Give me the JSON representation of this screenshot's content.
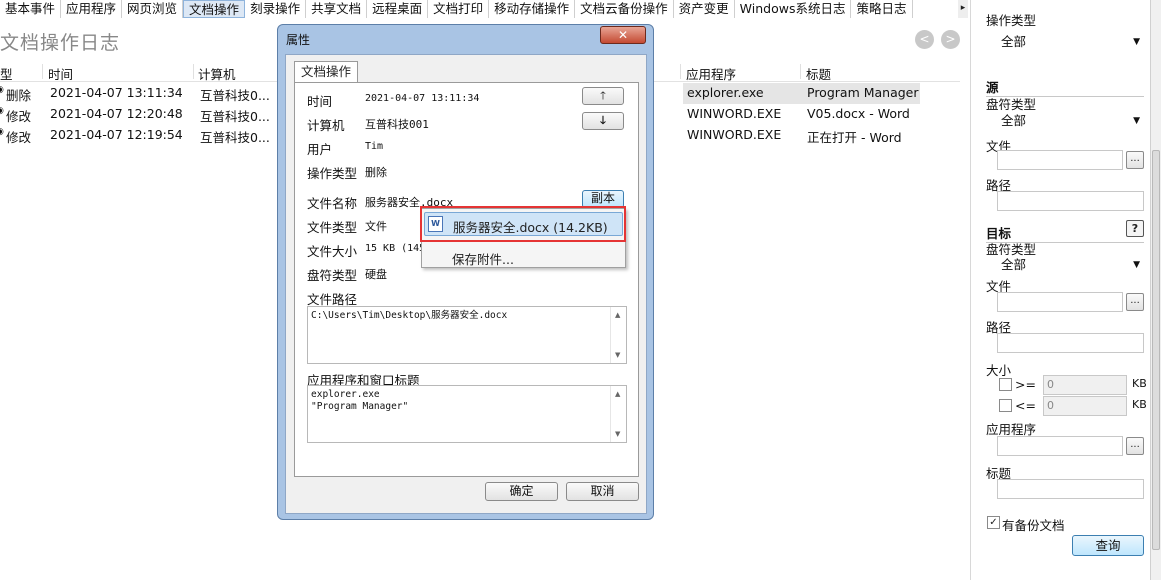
{
  "tabs": [
    "基本事件",
    "应用程序",
    "网页浏览",
    "文档操作",
    "刻录操作",
    "共享文档",
    "远程桌面",
    "文档打印",
    "移动存储操作",
    "文档云备份操作",
    "资产变更",
    "Windows系统日志",
    "策略日志"
  ],
  "active_tab_index": 3,
  "main_title": "文档操作日志",
  "nav": {
    "back": "<",
    "forward": ">"
  },
  "list": {
    "columns": {
      "type": "型",
      "time": "时间",
      "computer": "计算机",
      "app": "应用程序",
      "title": "标题"
    },
    "rows": [
      {
        "type": "删除",
        "time": "2021-04-07 13:11:34",
        "computer": "互普科技0...",
        "app": "explorer.exe",
        "title": "Program Manager"
      },
      {
        "type": "修改",
        "time": "2021-04-07 12:20:48",
        "computer": "互普科技0...",
        "app": "WINWORD.EXE",
        "title": "V05.docx - Word"
      },
      {
        "type": "修改",
        "time": "2021-04-07 12:19:54",
        "computer": "互普科技0...",
        "app": "WINWORD.EXE",
        "title": "正在打开 - Word"
      }
    ]
  },
  "right_panel": {
    "op_type_label": "操作类型",
    "op_type_value": "全部",
    "source_title": "源",
    "src_drive_label": "盘符类型",
    "src_drive_value": "全部",
    "src_file_label": "文件",
    "src_path_label": "路径",
    "target_title": "目标",
    "help": "?",
    "tgt_drive_label": "盘符类型",
    "tgt_drive_value": "全部",
    "tgt_file_label": "文件",
    "tgt_path_label": "路径",
    "size_label": "大小",
    "size_ge": ">=",
    "size_le": "<=",
    "size_ge_value": "0",
    "size_le_value": "0",
    "size_unit": "KB",
    "app_label": "应用程序",
    "title_label": "标题",
    "has_backup_label": "有备份文档",
    "has_backup_checked": true,
    "query_button": "查询",
    "browse": "..."
  },
  "dialog": {
    "title": "属性",
    "close": "✕",
    "tab": "文档操作",
    "time_label": "时间",
    "time_value": "2021-04-07 13:11:34",
    "computer_label": "计算机",
    "computer_value": "互普科技001",
    "user_label": "用户",
    "user_value": "Tim",
    "optype_label": "操作类型",
    "optype_value": "删除",
    "filename_label": "文件名称",
    "filename_value": "服务器安全.docx",
    "copy_button": "副本",
    "filetype_label": "文件类型",
    "filetype_value": "文件",
    "filesize_label": "文件大小",
    "filesize_value": "15 KB (145",
    "drive_label": "盘符类型",
    "drive_value": "硬盘",
    "path_label": "文件路径",
    "path_value": "C:\\Users\\Tim\\Desktop\\服务器安全.docx",
    "appwin_label": "应用程序和窗口标题",
    "appwin_value": "explorer.exe\n\"Program Manager\"",
    "up": "🡑",
    "down": "🡓",
    "ok_button": "确定",
    "cancel_button": "取消"
  },
  "popup": {
    "item1": "服务器安全.docx (14.2KB)",
    "item2": "保存附件..."
  }
}
